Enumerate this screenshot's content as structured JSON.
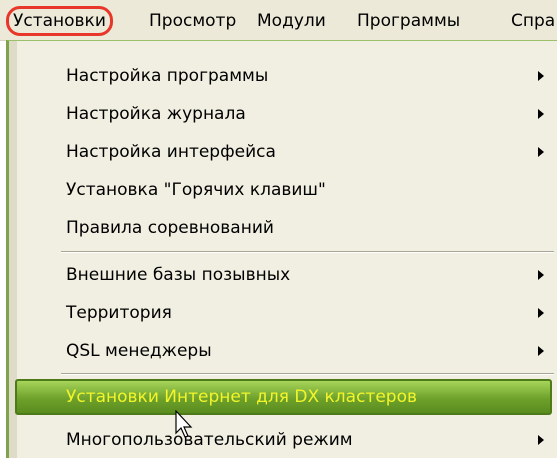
{
  "menubar": {
    "items": [
      "Установки",
      "Просмотр",
      "Модули",
      "Программы",
      "Спра"
    ]
  },
  "menu": {
    "items": [
      {
        "label": "Настройка программы",
        "submenu": true
      },
      {
        "label": "Настройка журнала",
        "submenu": true
      },
      {
        "label": "Настройка интерфейса",
        "submenu": true
      },
      {
        "label": "Установка \"Горячих клавиш\"",
        "submenu": false
      },
      {
        "label": "Правила соревнований",
        "submenu": false
      },
      {
        "label": "Внешние базы позывных",
        "submenu": true
      },
      {
        "label": "Территория",
        "submenu": true
      },
      {
        "label": "QSL менеджеры",
        "submenu": true
      },
      {
        "label": "Установки Интернет для DX кластеров",
        "submenu": false,
        "highlighted": true
      },
      {
        "label": "Многопользовательский режим",
        "submenu": true
      }
    ]
  },
  "colors": {
    "highlight_bg": "#6ea12b",
    "highlight_text": "#f2f52a",
    "active_outline": "#e8372a"
  },
  "icons": {
    "submenu": "submenu-arrow-icon",
    "pointer": "mouse-pointer-icon"
  }
}
